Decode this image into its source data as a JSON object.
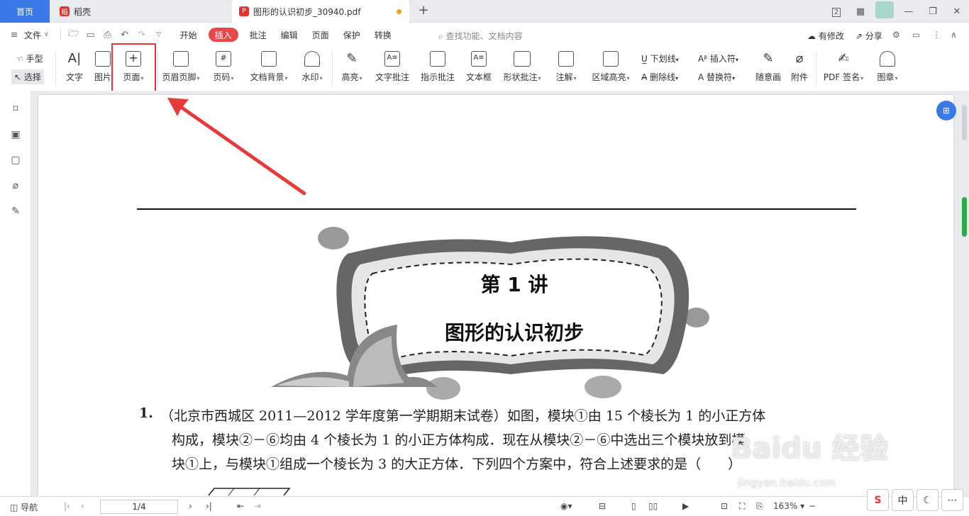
{
  "tabs": {
    "home": "首页",
    "daoke": "稻壳",
    "doc": "图形的认识初步_30940.pdf",
    "new": "+"
  },
  "window": {
    "badge": "2",
    "minimize": "—",
    "restore": "❐",
    "close": "✕"
  },
  "menu": {
    "file": "文件",
    "items": [
      "开始",
      "插入",
      "批注",
      "编辑",
      "页面",
      "保护",
      "转换"
    ],
    "active": "插入",
    "search": "查找功能、文档内容",
    "modify": "有修改",
    "share": "分享"
  },
  "tools": {
    "hand": "手型",
    "select": "选择"
  },
  "ribbon": {
    "text": "文字",
    "image": "图片",
    "page": "页面",
    "header_footer": "页眉页脚",
    "page_num": "页码",
    "bg": "文档背景",
    "watermark": "水印",
    "highlight": "高亮",
    "text_comment": "文字批注",
    "pointer_comment": "指示批注",
    "textbox": "文本框",
    "shape_comment": "形状批注",
    "note": "注解",
    "area_highlight": "区域高亮",
    "underline": "下划线",
    "strike": "删除线",
    "insert_char": "插入符",
    "replace_char": "替换符",
    "freehand": "随意画",
    "attach": "附件",
    "pdf_sign": "PDF 签名",
    "stamp": "图章"
  },
  "doc": {
    "lecture": "第 1 讲",
    "subtitle": "图形的认识初步",
    "q_num": "1.",
    "q_line1": "（北京市西城区 2011—2012 学年度第一学期期末试卷）如图，模块①由 15 个棱长为 1 的小正方体",
    "q_line2": "构成，模块②－⑥均由 4 个棱长为 1 的小正方体构成．现在从模块②－⑥中选出三个模块放到模",
    "q_line3": "块①上，与模块①组成一个棱长为 3 的大正方体．下列四个方案中，符合上述要求的是（　　）"
  },
  "watermark": {
    "main": "Baidu 经验",
    "url": "jingyan.baidu.com"
  },
  "status": {
    "nav": "导航",
    "page": "1/4",
    "zoom": "163%"
  },
  "ime": {
    "sogou": "S",
    "lang": "中",
    "moon": "☾",
    "more": "⋯"
  },
  "colors": {
    "accent": "#3a79e8",
    "insert_tab": "#e8484a",
    "highlight_box": "#ee3333",
    "scroll_thumb": "#2faa4a"
  }
}
